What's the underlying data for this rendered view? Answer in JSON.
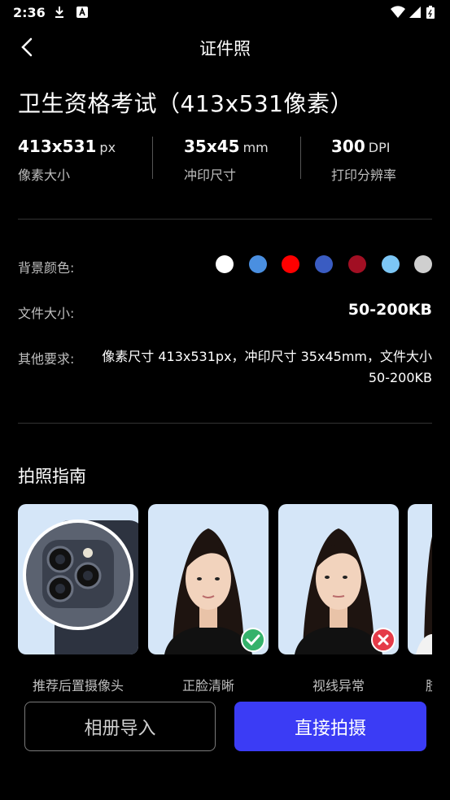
{
  "status_bar": {
    "time": "2:36"
  },
  "app_bar": {
    "title": "证件照"
  },
  "main": {
    "title": "卫生资格考试（413x531像素）",
    "specs": [
      {
        "value": "413x531",
        "unit": "px",
        "label": "像素大小"
      },
      {
        "value": "35x45",
        "unit": "mm",
        "label": "冲印尺寸"
      },
      {
        "value": "300",
        "unit": "DPI",
        "label": "打印分辨率"
      }
    ],
    "bg_color_label": "背景颜色:",
    "bg_colors": [
      "#ffffff",
      "#4a8fe0",
      "#ff0000",
      "#3a5cc2",
      "#a10f23",
      "#7cc6f5",
      "#cfcfcf"
    ],
    "file_size_label": "文件大小:",
    "file_size_value": "50-200KB",
    "other_req_label": "其他要求:",
    "other_req_value": "像素尺寸 413x531px，冲印尺寸 35x45mm，文件大小 50-200KB"
  },
  "guide": {
    "title": "拍照指南",
    "cards": [
      {
        "caption": "推荐后置摄像头"
      },
      {
        "caption": "正脸清晰"
      },
      {
        "caption": "视线异常"
      },
      {
        "caption": "肢"
      }
    ]
  },
  "buttons": {
    "album_label": "相册导入",
    "shoot_label": "直接拍摄"
  },
  "colors": {
    "accent": "#3b3cf5",
    "ok": "#35b26b",
    "bad": "#e53b48"
  }
}
